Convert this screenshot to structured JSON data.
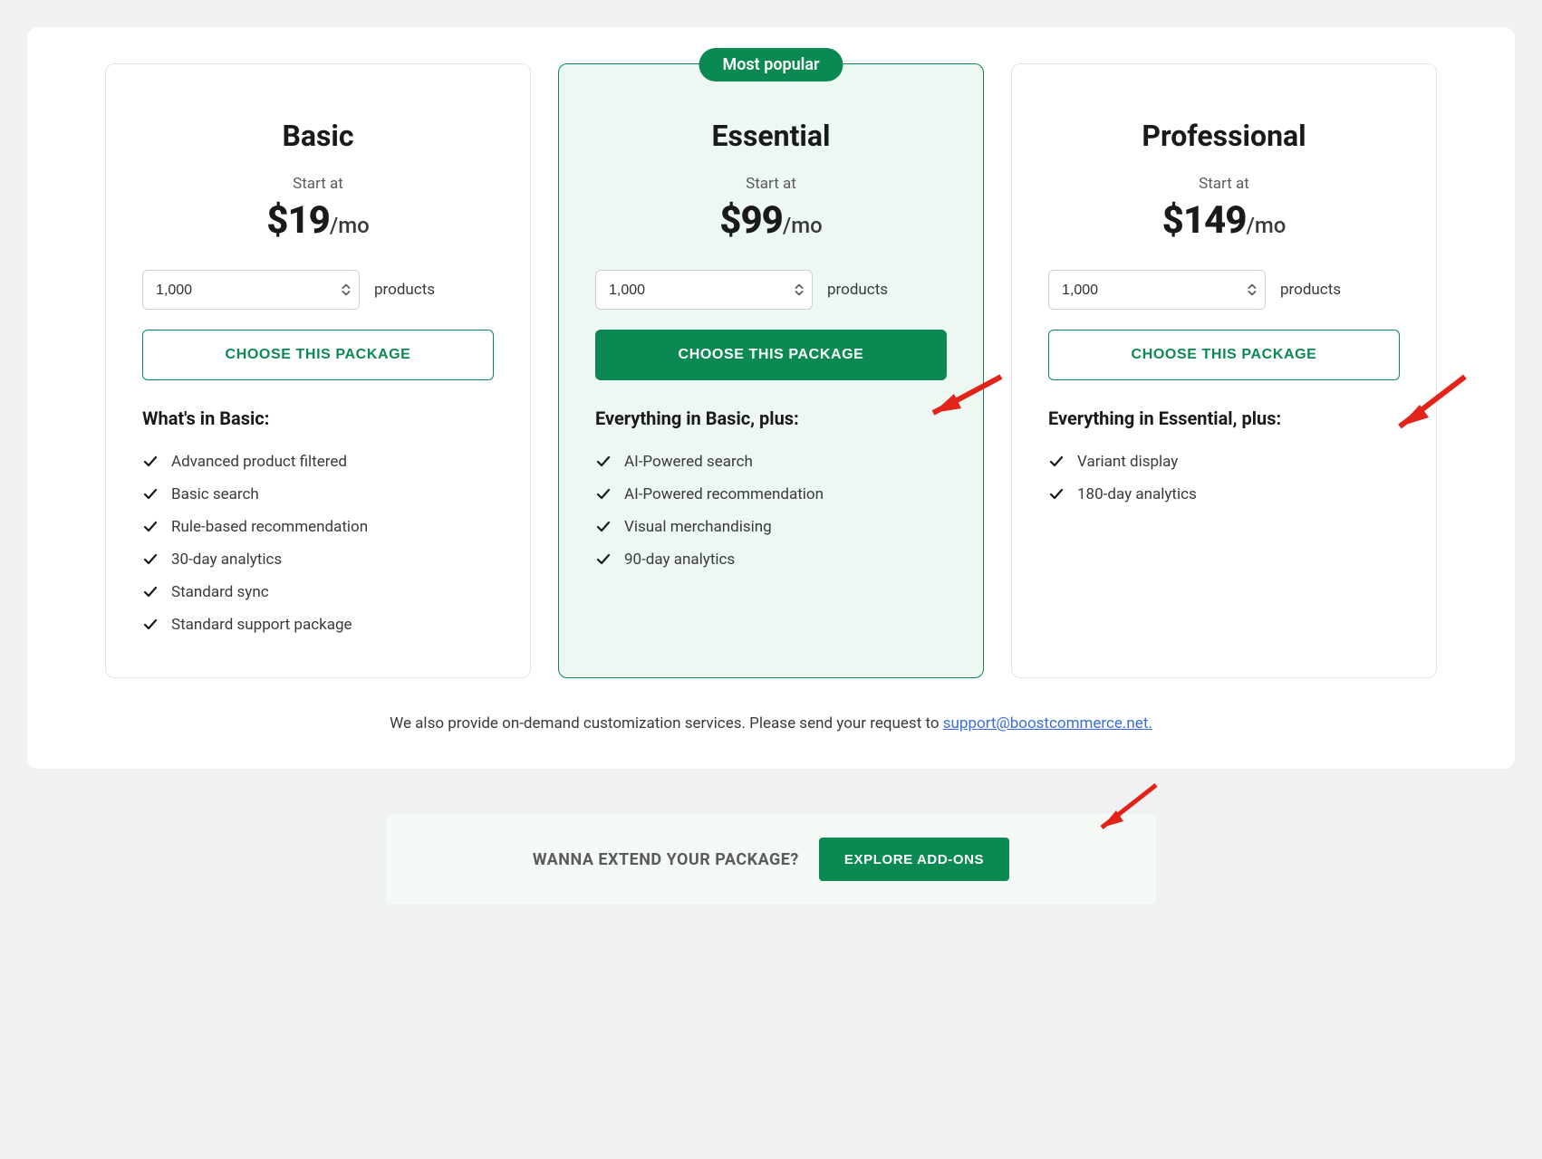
{
  "badge": "Most popular",
  "startAtLabel": "Start at",
  "productsLabel": "products",
  "selectValue": "1,000",
  "ctaLabel": "CHOOSE THIS PACKAGE",
  "plans": [
    {
      "name": "Basic",
      "price": "$19",
      "per": "/mo",
      "featuresTitle": "What's in Basic:",
      "features": [
        "Advanced product filtered",
        "Basic search",
        "Rule-based recommendation",
        "30-day analytics",
        "Standard sync",
        "Standard support package"
      ],
      "featured": false
    },
    {
      "name": "Essential",
      "price": "$99",
      "per": "/mo",
      "featuresTitle": "Everything in Basic, plus:",
      "features": [
        "AI-Powered search",
        "AI-Powered recommendation",
        "Visual merchandising",
        "90-day analytics"
      ],
      "featured": true
    },
    {
      "name": "Professional",
      "price": "$149",
      "per": "/mo",
      "featuresTitle": "Everything in Essential, plus:",
      "features": [
        "Variant display",
        "180-day analytics"
      ],
      "featured": false
    }
  ],
  "footerNote": {
    "text": "We also provide on-demand customization services. Please send your request to ",
    "linkText": "support@boostcommerce.net."
  },
  "extend": {
    "text": "WANNA EXTEND YOUR PACKAGE?",
    "button": "EXPLORE ADD-ONS"
  }
}
